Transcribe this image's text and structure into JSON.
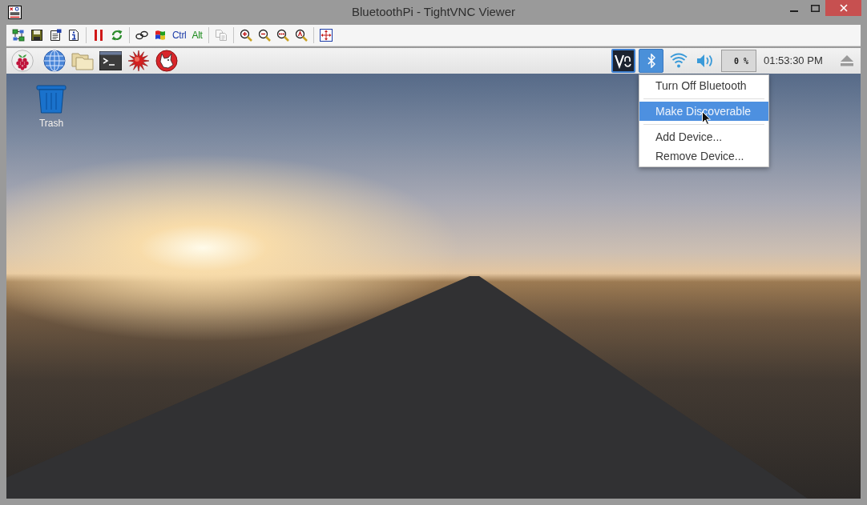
{
  "window": {
    "title": "BluetoothPi - TightVNC Viewer"
  },
  "toolbar": {
    "groups": [
      [
        {
          "kind": "icon",
          "disabled": false
        },
        {
          "kind": "icon",
          "disabled": false
        },
        {
          "kind": "icon",
          "disabled": false
        },
        {
          "kind": "icon",
          "disabled": false
        }
      ],
      [
        {
          "kind": "icon",
          "disabled": false
        },
        {
          "kind": "icon",
          "disabled": false
        }
      ],
      [
        {
          "kind": "icon",
          "disabled": false
        },
        {
          "kind": "icon",
          "disabled": false
        },
        {
          "kind": "text",
          "label": "Ctrl",
          "color": "#1c3ca8",
          "disabled": false
        },
        {
          "kind": "text",
          "label": "Alt",
          "color": "#1a8a1a",
          "disabled": false
        }
      ],
      [
        {
          "kind": "icon",
          "disabled": true
        }
      ],
      [
        {
          "kind": "icon",
          "disabled": false
        },
        {
          "kind": "icon",
          "disabled": false
        },
        {
          "kind": "icon",
          "disabled": false
        },
        {
          "kind": "icon",
          "disabled": false
        }
      ],
      [
        {
          "kind": "icon",
          "disabled": false
        }
      ]
    ]
  },
  "panel": {
    "bluetooth": {
      "menu_open": true
    },
    "cpu_usage": "0 %",
    "clock": "01:53:30 PM"
  },
  "desktop": {
    "icons": [
      {
        "label": "Trash"
      }
    ]
  },
  "bluetooth_menu": {
    "groups": [
      [
        {
          "label": "Turn Off Bluetooth",
          "selected": false
        }
      ],
      [
        {
          "label": "Make Discoverable",
          "selected": true
        }
      ],
      [
        {
          "label": "Add Device...",
          "selected": false
        },
        {
          "label": "Remove Device...",
          "selected": false
        }
      ]
    ]
  }
}
